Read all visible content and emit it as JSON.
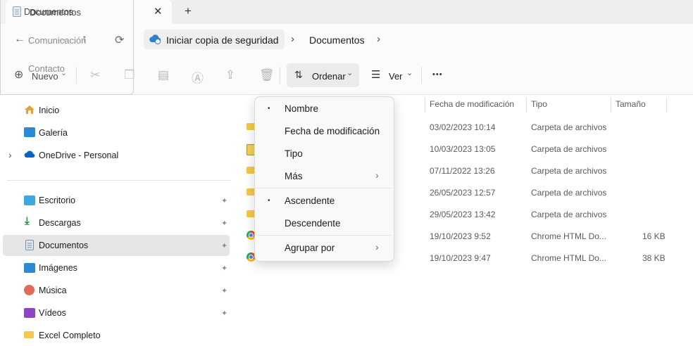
{
  "tab": {
    "title": "Documentos",
    "close": "✕",
    "new": "+"
  },
  "nav": {
    "back": "←",
    "forward": "→",
    "up": "↑",
    "refresh": "⟳"
  },
  "breadcrumb": {
    "backup": "Iniciar copia de seguridad",
    "current": "Documentos",
    "sep": "›"
  },
  "ghost": {
    "title": "Documentos",
    "item1": "Comunicación",
    "item2": "Contacto"
  },
  "toolbar": {
    "new_label": "Nuevo",
    "sort_label": "Ordenar",
    "view_label": "Ver",
    "more": "•••",
    "chev": "⌄"
  },
  "sidebar": {
    "items": [
      {
        "label": "Inicio"
      },
      {
        "label": "Galería"
      },
      {
        "label": "OneDrive - Personal"
      },
      {
        "label": "Escritorio"
      },
      {
        "label": "Descargas"
      },
      {
        "label": "Documentos"
      },
      {
        "label": "Imágenes"
      },
      {
        "label": "Música"
      },
      {
        "label": "Vídeos"
      },
      {
        "label": "Excel Completo"
      }
    ],
    "expand_glyph": "›",
    "pin_glyph": "📌"
  },
  "columns": {
    "date": "Fecha de modificación",
    "type": "Tipo",
    "size": "Tamaño"
  },
  "rows": [
    {
      "date": "03/02/2023 10:14",
      "type": "Carpeta de archivos",
      "size": ""
    },
    {
      "date": "10/03/2023 13:05",
      "type": "Carpeta de archivos",
      "size": ""
    },
    {
      "date": "07/11/2022 13:26",
      "type": "Carpeta de archivos",
      "size": ""
    },
    {
      "date": "26/05/2023 12:57",
      "type": "Carpeta de archivos",
      "size": ""
    },
    {
      "date": "29/05/2023 13:42",
      "type": "Carpeta de archivos",
      "size": ""
    },
    {
      "date": "19/10/2023 9:52",
      "type": "Chrome HTML Do...",
      "size": "16 KB"
    },
    {
      "date": "19/10/2023 9:47",
      "type": "Chrome HTML Do...",
      "size": "38 KB"
    }
  ],
  "sort_menu": {
    "items": [
      {
        "label": "Nombre"
      },
      {
        "label": "Fecha de modificación"
      },
      {
        "label": "Tipo"
      },
      {
        "label": "Más"
      },
      {
        "label": "Ascendente"
      },
      {
        "label": "Descendente"
      },
      {
        "label": "Agrupar por"
      }
    ],
    "bullet": "•",
    "arrow": "›"
  },
  "colors": {
    "folder": "#f4c84a",
    "accent": "#0067c0",
    "selected_bg": "#e6e6e6"
  }
}
